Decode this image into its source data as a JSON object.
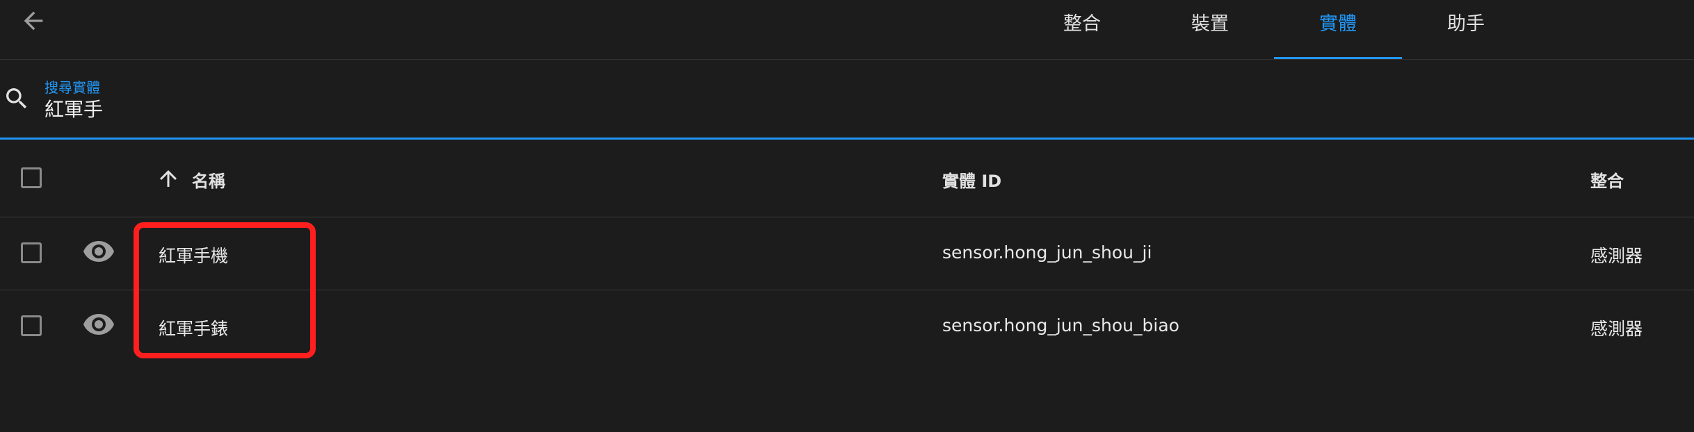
{
  "header": {
    "tabs": [
      {
        "label": "整合",
        "active": false
      },
      {
        "label": "裝置",
        "active": false
      },
      {
        "label": "實體",
        "active": true
      },
      {
        "label": "助手",
        "active": false
      }
    ]
  },
  "search": {
    "label": "搜尋實體",
    "value": "紅軍手"
  },
  "table": {
    "columns": {
      "name": "名稱",
      "entity_id": "實體 ID",
      "integration": "整合"
    },
    "rows": [
      {
        "name": "紅軍手機",
        "entity_id": "sensor.hong_jun_shou_ji",
        "integration": "感測器"
      },
      {
        "name": "紅軍手錶",
        "entity_id": "sensor.hong_jun_shou_biao",
        "integration": "感測器"
      }
    ]
  },
  "colors": {
    "accent": "#2196f3",
    "background": "#1c1c1c",
    "highlight": "#ff1f1f"
  }
}
